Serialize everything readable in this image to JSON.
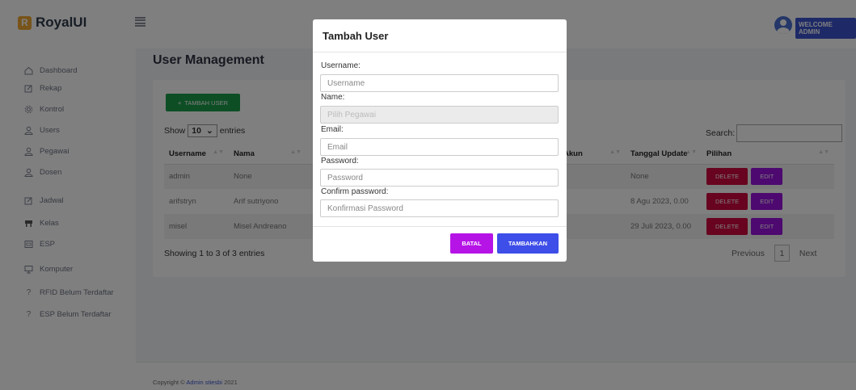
{
  "brand": {
    "logo_letter": "R",
    "name": "RoyalUI"
  },
  "header": {
    "welcome_label": "WELCOME ADMIN"
  },
  "sidebar": {
    "items": [
      {
        "label": "Dashboard",
        "icon": "home-icon"
      },
      {
        "label": "Rekap",
        "icon": "edit-icon"
      },
      {
        "label": "Kontrol",
        "icon": "settings-icon"
      },
      {
        "label": "Users",
        "icon": "user-icon"
      },
      {
        "label": "Pegawai",
        "icon": "user-icon"
      },
      {
        "label": "Dosen",
        "icon": "user-icon"
      },
      {
        "label": "Jadwal",
        "icon": "edit-icon"
      },
      {
        "label": "Kelas",
        "icon": "table-icon"
      },
      {
        "label": "ESP",
        "icon": "chip-icon"
      },
      {
        "label": "Komputer",
        "icon": "monitor-icon"
      },
      {
        "label": "RFID Belum Terdaftar",
        "icon": "question-icon"
      },
      {
        "label": "ESP Belum Terdaftar",
        "icon": "question-icon"
      }
    ]
  },
  "main": {
    "title": "User Management",
    "add_button": "TAMBAH USER",
    "show_label": "Show",
    "entries_value": "10",
    "entries_label": "entries",
    "search_label": "Search:",
    "table": {
      "headers": [
        "Username",
        "Nama",
        "",
        "Akun",
        "Tanggal Update",
        "Pilihan"
      ],
      "rows": [
        {
          "username": "admin",
          "nama": "None",
          "tanggal": "None"
        },
        {
          "username": "arifstryn",
          "nama": "Arif sutriyono",
          "tanggal": "8 Agu 2023, 0.00"
        },
        {
          "username": "misel",
          "nama": "Misel Andreano",
          "tanggal": "29 Juli 2023, 0.00"
        }
      ],
      "delete_label": "DELETE",
      "edit_label": "EDIT"
    },
    "info": "Showing 1 to 3 of 3 entries",
    "pager": {
      "previous": "Previous",
      "page": "1",
      "next": "Next"
    }
  },
  "footer": {
    "prefix": "Copyright ©",
    "link": "Admin stiesbi",
    "year": "2021"
  },
  "modal": {
    "title": "Tambah User",
    "username_label": "Username:",
    "username_placeholder": "Username",
    "name_label": "Name:",
    "name_placeholder": "Pilih Pegawai",
    "email_label": "Email:",
    "email_placeholder": "Email",
    "password_label": "Password:",
    "password_placeholder": "Password",
    "confirm_label": "Confirm password:",
    "confirm_placeholder": "Konfirmasi Password",
    "cancel_button": "BATAL",
    "submit_button": "TAMBAHKAN"
  }
}
